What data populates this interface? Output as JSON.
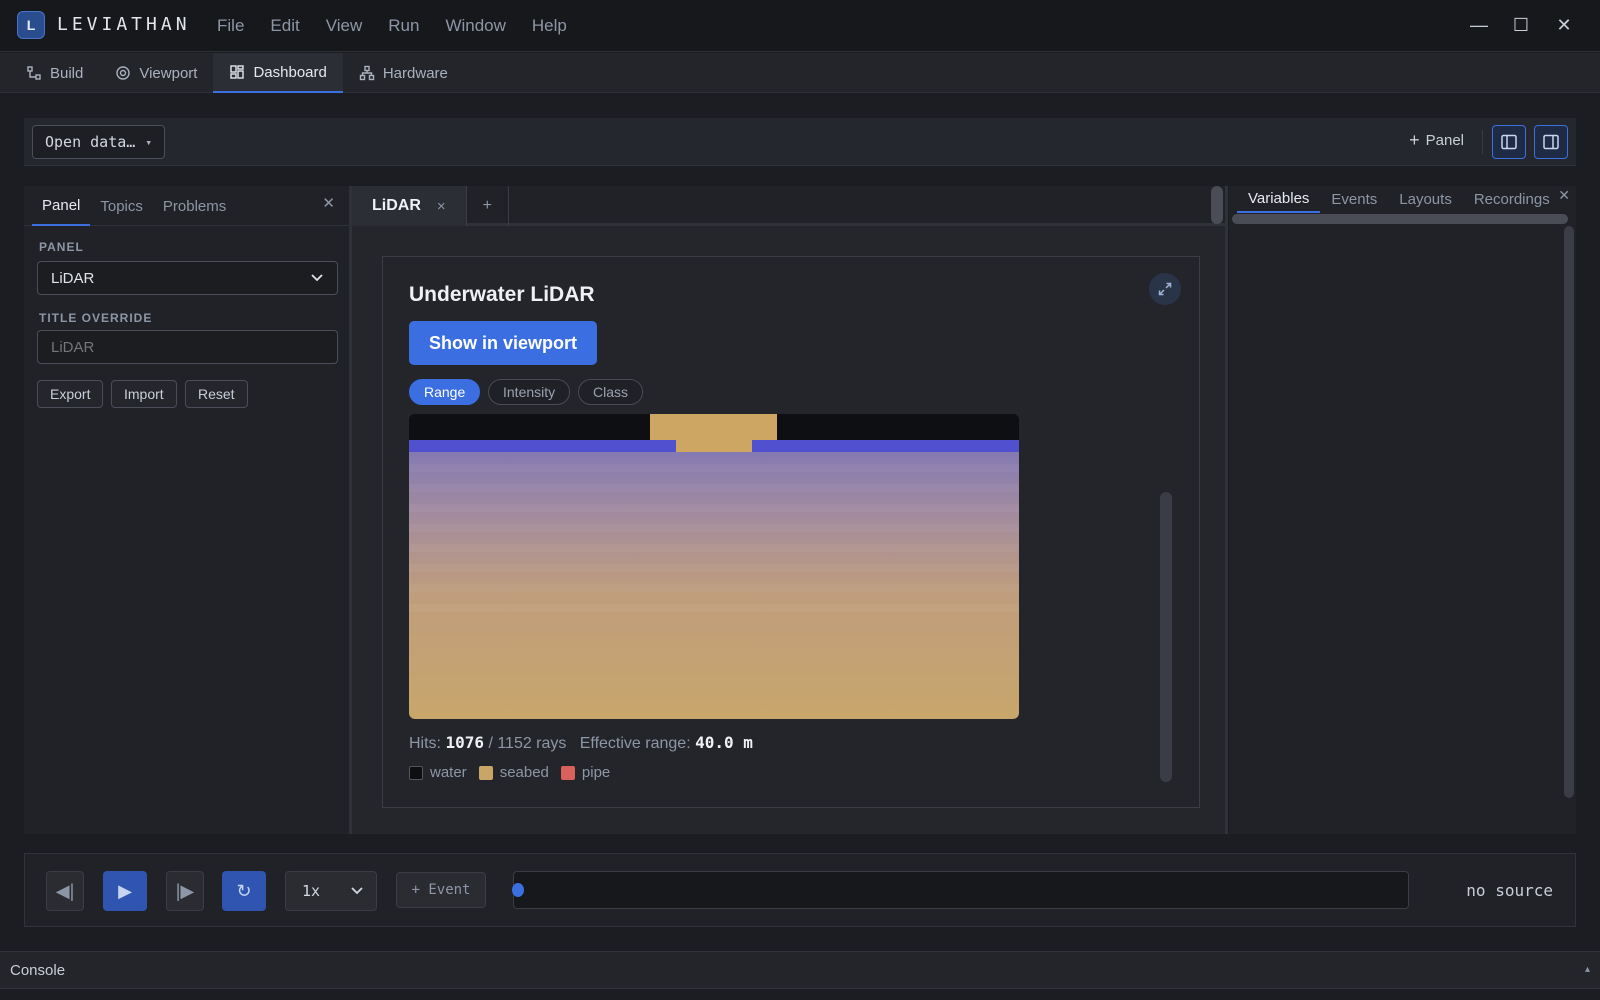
{
  "app": {
    "logo_letter": "L",
    "name": "LEVIATHAN"
  },
  "menu": [
    "File",
    "Edit",
    "View",
    "Run",
    "Window",
    "Help"
  ],
  "window_controls": {
    "minimize": "—",
    "maximize": "☐",
    "close": "✕"
  },
  "main_tabs": [
    {
      "label": "Build",
      "icon": "build-icon"
    },
    {
      "label": "Viewport",
      "icon": "viewport-icon"
    },
    {
      "label": "Dashboard",
      "icon": "dashboard-icon",
      "active": true
    },
    {
      "label": "Hardware",
      "icon": "hardware-icon"
    }
  ],
  "toolbar": {
    "open_data_label": "Open data…",
    "open_data_caret": "▾",
    "add_panel_label": "Panel",
    "add_panel_icon": "+"
  },
  "left_panel": {
    "tabs": [
      "Panel",
      "Topics",
      "Problems"
    ],
    "close": "✕",
    "panel_section_label": "PANEL",
    "panel_select_value": "LiDAR",
    "title_override_label": "TITLE OVERRIDE",
    "title_override_placeholder": "LiDAR",
    "buttons": [
      "Export",
      "Import",
      "Reset"
    ]
  },
  "center": {
    "tabs": [
      {
        "label": "LiDAR",
        "close": "×"
      }
    ],
    "add_tab": "+",
    "card": {
      "title": "Underwater LiDAR",
      "show_button": "Show in viewport",
      "modes": [
        "Range",
        "Intensity",
        "Class"
      ],
      "active_mode": "Range",
      "stats": {
        "hits_label": "Hits:",
        "hits": "1076",
        "rays": "/ 1152 rays",
        "range_label": "Effective range:",
        "range": "40.0 m"
      },
      "legend": [
        {
          "label": "water",
          "color": "#0d0f12"
        },
        {
          "label": "seabed",
          "color": "#c9a666"
        },
        {
          "label": "pipe",
          "color": "#d9615c"
        }
      ]
    }
  },
  "right_panel": {
    "tabs": [
      "Variables",
      "Events",
      "Layouts",
      "Recordings"
    ],
    "close": "✕"
  },
  "playback": {
    "step_back": "◀|",
    "play": "▶",
    "step_forward": "|▶",
    "loop": "↻",
    "speed": "1x",
    "add_event": "+ Event",
    "source": "no source",
    "position": 0
  },
  "console": {
    "label": "Console",
    "toggle": "▴"
  },
  "colors": {
    "accent": "#3b6ee0",
    "background": "#1b1d22"
  }
}
